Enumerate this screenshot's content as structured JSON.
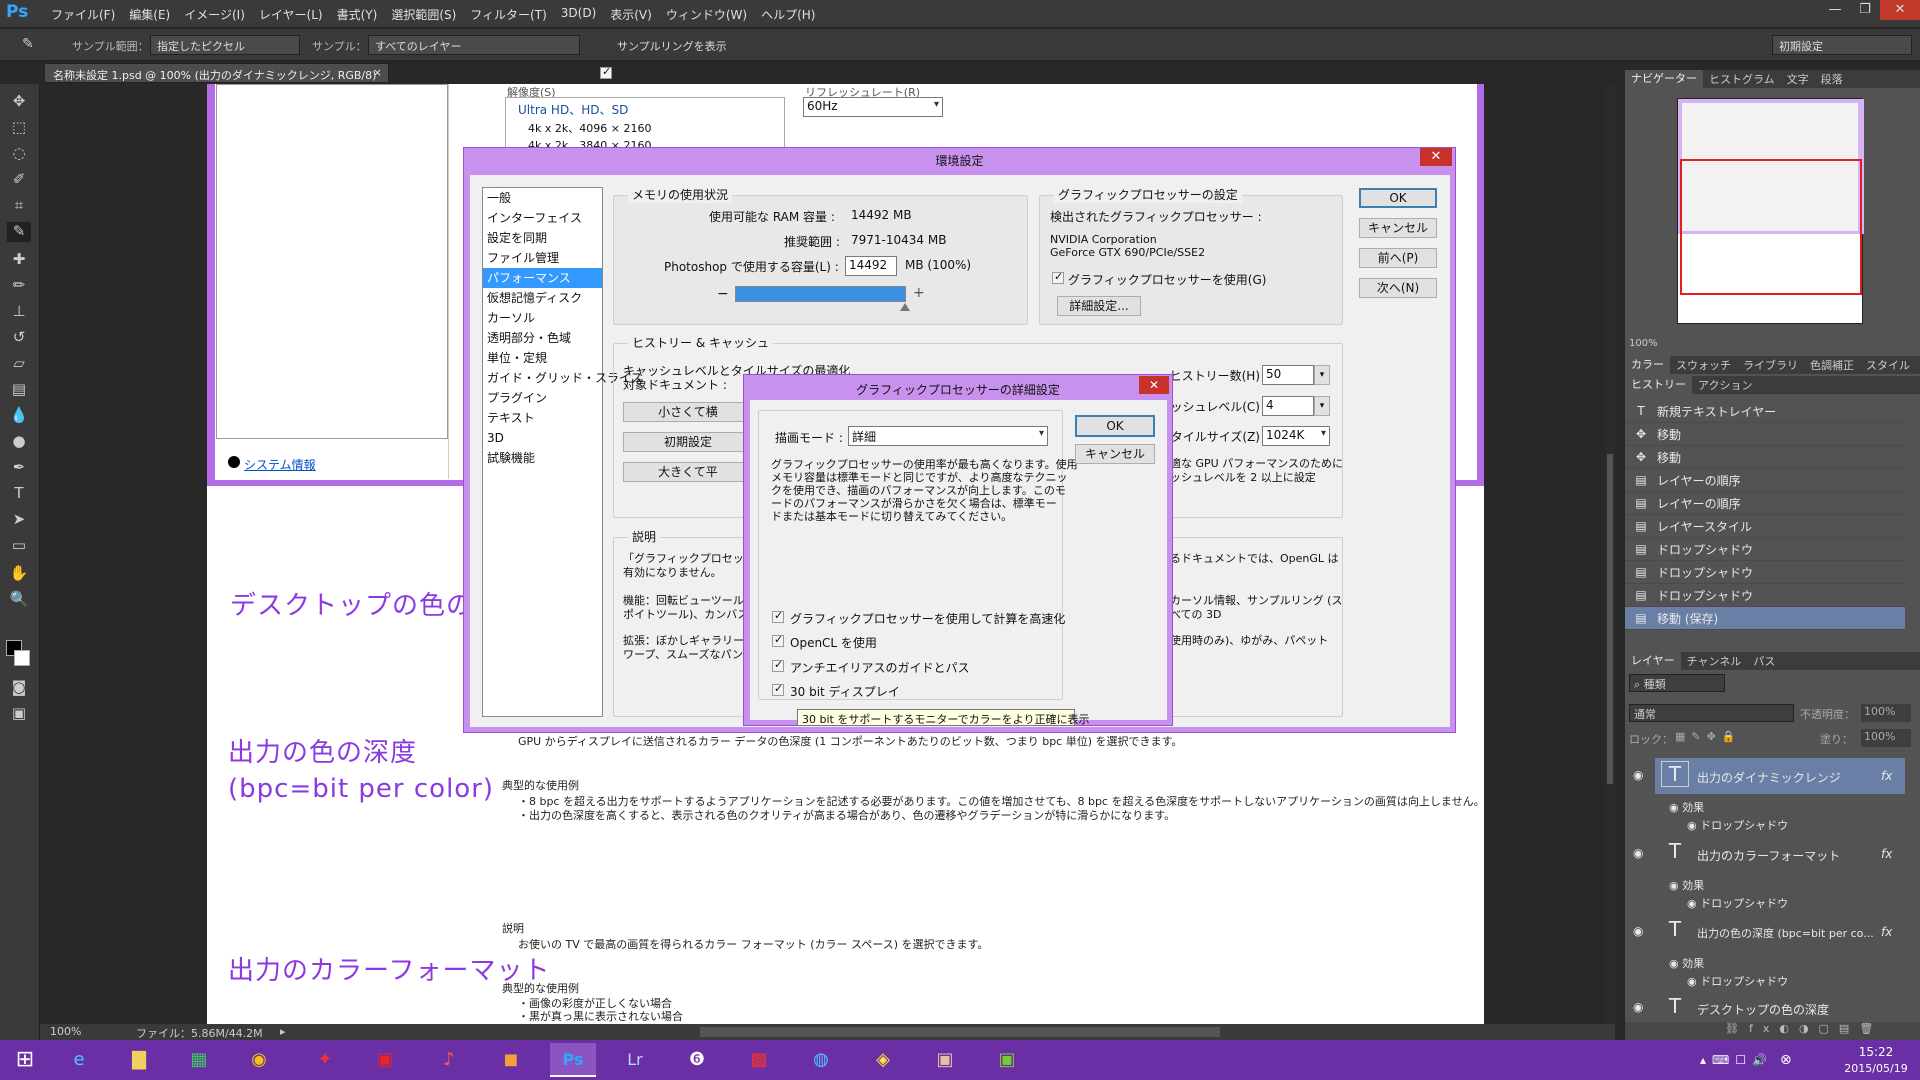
{
  "app": {
    "logo": "Ps",
    "menus": [
      "ファイル(F)",
      "編集(E)",
      "イメージ(I)",
      "レイヤー(L)",
      "書式(Y)",
      "選択範囲(S)",
      "フィルター(T)",
      "3D(D)",
      "表示(V)",
      "ウィンドウ(W)",
      "ヘルプ(H)"
    ],
    "window_controls": [
      "—",
      "❐",
      "✕"
    ]
  },
  "options_bar": {
    "sample_size_label": "サンプル範囲：",
    "sample_size_value": "指定したピクセル",
    "sample_label": "サンプル：",
    "sample_value": "すべてのレイヤー",
    "show_ring_label": "サンプルリングを表示",
    "workspace": "初期設定"
  },
  "document_tab": "名称未設定 1.psd @ 100% (出力のダイナミックレンジ, RGB/8)",
  "canvas": {
    "resolution_label": "解像度(S)",
    "refresh_label": "リフレッシュレート(R)",
    "refresh_value": "60Hz",
    "resolution_group": "Ultra HD、HD、SD",
    "resolutions": [
      "4k x 2k、4096 × 2160",
      "4k x 2k、3840 × 2160"
    ],
    "system_info": "システム情報",
    "labels": {
      "desktop_depth": "デスクトップの色の深度",
      "output_depth": "出力の色の深度",
      "bpc": "(bpc=bit per color)",
      "color_format": "出力のカラーフォーマット"
    },
    "paragraphs": {
      "p1": "GPU からディスプレイに送信されるカラー データの色深度 (1 コンポーネントあたりのビット数、つまり bpc 単位) を選択できます。",
      "p2_title": "典型的な使用例",
      "p2_l1": "・8 bpc を超える出力をサポートするようアプリケーションを記述する必要があります。この値を増加させても、8 bpc を超える色深度をサポートしないアプリケーションの画質は向上しません。",
      "p2_l2": "・出力の色深度を高くすると、表示される色のクオリティが高まる場合があり、色の遷移やグラデーションが特に滑らかになります。",
      "p3_title": "説明",
      "p3_l1": "お使いの TV で最高の画質を得られるカラー フォーマット (カラー スペース) を選択できます。",
      "p4_title": "典型的な使用例",
      "p4_l1": "・画像の彩度が正しくない場合",
      "p4_l2": "・黒が真っ黒に表示されない場合"
    }
  },
  "prefs": {
    "title": "環境設定",
    "list": [
      "一般",
      "インターフェイス",
      "設定を同期",
      "ファイル管理",
      "パフォーマンス",
      "仮想記憶ディスク",
      "カーソル",
      "透明部分・色域",
      "単位・定規",
      "ガイド・グリッド・スライス",
      "プラグイン",
      "テキスト",
      "3D",
      "試験機能"
    ],
    "selected": "パフォーマンス",
    "memory": {
      "title": "メモリの使用状況",
      "available_label": "使用可能な RAM 容量 :",
      "available_value": "14492 MB",
      "range_label": "推奨範囲 :",
      "range_value": "7971-10434 MB",
      "let_use_label": "Photoshop で使用する容量(L) :",
      "let_use_value": "14492",
      "let_use_unit": "MB (100%)",
      "slider_fraction": 1.0
    },
    "gpu_settings": {
      "title": "グラフィックプロセッサーの設定",
      "detected_label": "検出されたグラフィックプロセッサー :",
      "vendor": "NVIDIA Corporation",
      "model": "GeForce GTX 690/PCIe/SSE2",
      "use_gpu": "グラフィックプロセッサーを使用(G)",
      "advanced_button": "詳細設定..."
    },
    "history_cache": {
      "title": "ヒストリー & キャッシュ",
      "optimize_label": "キャッシュレベルとタイルサイズの最適化",
      "target_label": "対象ドキュメント :",
      "btn_tall": "小さくて横",
      "btn_default": "初期設定",
      "btn_big": "大きくて平",
      "history_label": "ヒストリー数(H) :",
      "history_value": "50",
      "cache_label": "キャッシュレベル(C) :",
      "cache_value": "4",
      "tile_label": "タイルサイズ(Z) :",
      "tile_value": "1024K",
      "note_l1": "適な GPU パフォーマンスのために",
      "note_l2": "ッシュレベルを 2 以上に設定"
    },
    "description": {
      "title": "説明",
      "l1": "「グラフィックプロセッサーを",
      "l1b": "るドキュメントでは、OpenGL は",
      "l2": "有効になりません。",
      "l3": "機能：回転ビューツール",
      "l3b": "カーソル情報、サンプルリング (ス",
      "l4": "ポイトツール)、カンバス上",
      "l4b": "べての 3D",
      "l5": "拡張：ぼかしギャラリー、",
      "l5b": "使用時のみ)、ゆがみ、パペット",
      "l6": "ワープ、スムーズなパンお"
    },
    "buttons": [
      "OK",
      "キャンセル",
      "前へ(P)",
      "次へ(N)"
    ]
  },
  "gpu_dialog": {
    "title": "グラフィックプロセッサーの詳細設定",
    "mode_label": "描画モード :",
    "mode_value": "詳細",
    "desc": [
      "グラフィックプロセッサーの使用率が最も高くなります。使用",
      "メモリ容量は標準モードと同じですが、より高度なテクニッ",
      "クを使用でき、描画のパフォーマンスが向上します。このモ",
      "ードのパフォーマンスが滑らかさを欠く場合は、標準モー",
      "ドまたは基本モードに切り替えてみてください。"
    ],
    "checks": [
      "グラフィックプロセッサーを使用して計算を高速化",
      "OpenCL を使用",
      "アンチエイリアスのガイドとパス",
      "30 bit ディスプレイ"
    ],
    "ok": "OK",
    "cancel": "キャンセル",
    "tooltip": "30 bit をサポートするモニターでカラーをより正確に表示"
  },
  "status": {
    "zoom": "100%",
    "file": "ファイル：5.86M/44.2M"
  },
  "panels": {
    "nav_tabs": [
      "ナビゲーター",
      "ヒストグラム",
      "文字",
      "段落"
    ],
    "nav_zoom": "100%",
    "color_tabs": [
      "カラー",
      "スウォッチ",
      "ライブラリ",
      "色調補正",
      "スタイル"
    ],
    "history_tabs": [
      "ヒストリー",
      "アクション"
    ],
    "history": [
      "新規テキストレイヤー",
      "移動",
      "移動",
      "レイヤーの順序",
      "レイヤーの順序",
      "レイヤースタイル",
      "ドロップシャドウ",
      "ドロップシャドウ",
      "ドロップシャドウ",
      "移動 (保存)"
    ],
    "layer_tabs": [
      "レイヤー",
      "チャンネル",
      "パス"
    ],
    "layer_filter": "種類",
    "blend_mode": "通常",
    "opacity_label": "不透明度：",
    "opacity_value": "100%",
    "lock_label": "ロック：",
    "fill_label": "塗り：",
    "fill_value": "100%",
    "layers": [
      {
        "name": "出力のダイナミックレンジ",
        "effects": "効果",
        "effect": "ドロップシャドウ"
      },
      {
        "name": "出力のカラーフォーマット",
        "effects": "効果",
        "effect": "ドロップシャドウ"
      },
      {
        "name": "出力の色の深度 (bpc=bit per co...",
        "effects": "効果",
        "effect": "ドロップシャドウ"
      },
      {
        "name": "デスクトップの色の深度"
      }
    ],
    "fx": "fx"
  },
  "taskbar": {
    "time": "15:22",
    "date": "2015/05/19"
  }
}
